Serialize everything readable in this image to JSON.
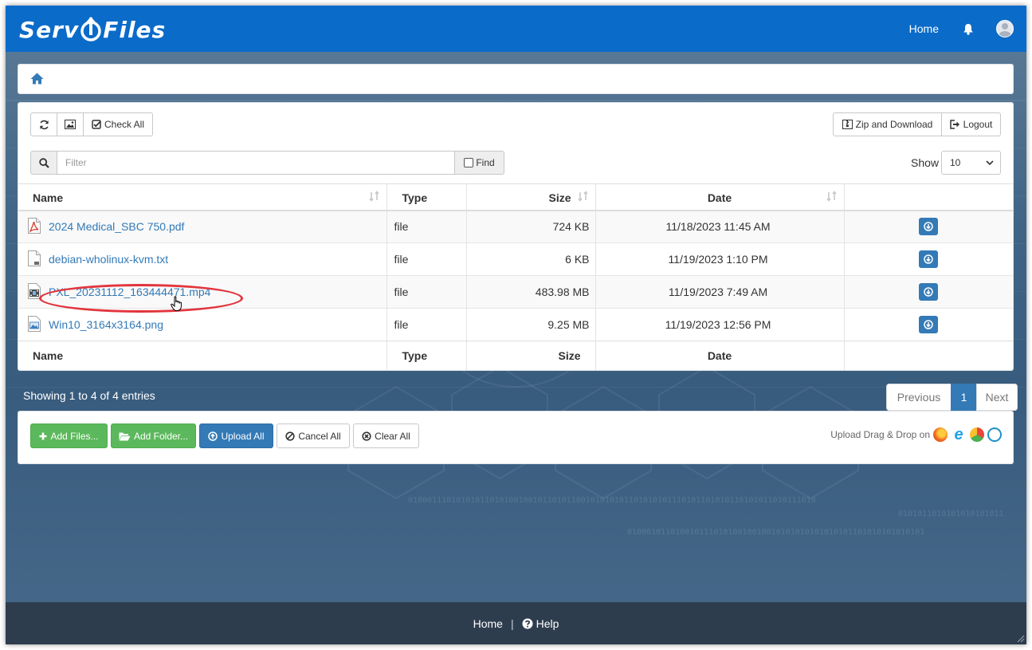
{
  "brand": {
    "name_left": "Serv",
    "name_right": "Files"
  },
  "nav": {
    "home": "Home",
    "bell_icon": "bell-icon",
    "avatar_icon": "user-avatar-icon"
  },
  "breadcrumb": {
    "icon": "home-icon"
  },
  "toolbar": {
    "refresh_icon": "refresh-icon",
    "image_icon": "image-icon",
    "check_all": "Check All",
    "zip_download": "Zip and Download",
    "logout": "Logout"
  },
  "filter": {
    "placeholder": "Filter",
    "find": "Find",
    "show_label": "Show",
    "show_value": "10"
  },
  "table": {
    "headers": {
      "name": "Name",
      "type": "Type",
      "size": "Size",
      "date": "Date"
    },
    "rows": [
      {
        "name": "2024 Medical_SBC 750.pdf",
        "type": "file",
        "size": "724 KB",
        "date": "11/18/2023 11:45 AM",
        "icon": "pdf-file-icon"
      },
      {
        "name": "debian-wholinux-kvm.txt",
        "type": "file",
        "size": "6 KB",
        "date": "11/19/2023 1:10 PM",
        "icon": "text-file-icon"
      },
      {
        "name": "PXL_20231112_163444471.mp4",
        "type": "file",
        "size": "483.98 MB",
        "date": "11/19/2023 7:49 AM",
        "icon": "video-file-icon"
      },
      {
        "name": "Win10_3164x3164.png",
        "type": "file",
        "size": "9.25 MB",
        "date": "11/19/2023 12:56 PM",
        "icon": "image-file-icon"
      }
    ]
  },
  "pagination": {
    "info": "Showing 1 to 4 of 4 entries",
    "previous": "Previous",
    "current": "1",
    "next": "Next"
  },
  "upload": {
    "add_files": "Add Files...",
    "add_folder": "Add Folder...",
    "upload_all": "Upload All",
    "cancel_all": "Cancel All",
    "clear_all": "Clear All",
    "drag_drop": "Upload Drag & Drop on",
    "browsers": [
      "firefox-icon",
      "internet-explorer-icon",
      "chrome-icon",
      "safari-icon"
    ]
  },
  "footer": {
    "home": "Home",
    "separator": "|",
    "help": "Help"
  },
  "colors": {
    "navbar": "#0b6bc9",
    "link": "#337ab7",
    "primary": "#337ab7",
    "success": "#5cb85c",
    "footer": "#2e3d4e",
    "highlight": "#e2353d"
  }
}
